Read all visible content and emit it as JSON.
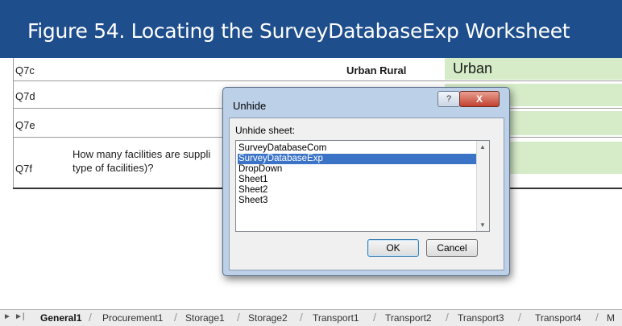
{
  "figure": {
    "title": "Figure 54. Locating the SurveyDatabaseExp Worksheet"
  },
  "sheet": {
    "rows": [
      {
        "id": "Q7c",
        "question": ""
      },
      {
        "id": "Q7d",
        "question": ""
      },
      {
        "id": "Q7e",
        "question": ""
      },
      {
        "id": "Q7f",
        "question_line1": "How many facilities are suppli",
        "question_line2": "type of facilities)?"
      }
    ],
    "urban_rural_label": "Urban Rural",
    "urban_value": "Urban",
    "green_fill": "#d6ecc9"
  },
  "dialog": {
    "title": "Unhide",
    "help_glyph": "?",
    "close_glyph": "X",
    "label": "Unhide sheet:",
    "items": [
      "SurveyDatabaseCom",
      "SurveyDatabaseExp",
      "DropDown",
      "Sheet1",
      "Sheet2",
      "Sheet3"
    ],
    "selected": "SurveyDatabaseExp",
    "ok": "OK",
    "cancel": "Cancel",
    "selection_color": "#3b74c7"
  },
  "tabs": {
    "active": "General1",
    "items": [
      "General1",
      "Procurement1",
      "Storage1",
      "Storage2",
      "Transport1",
      "Transport2",
      "Transport3",
      "Transport4",
      "M"
    ]
  },
  "colors": {
    "banner": "#1f4e8c"
  }
}
